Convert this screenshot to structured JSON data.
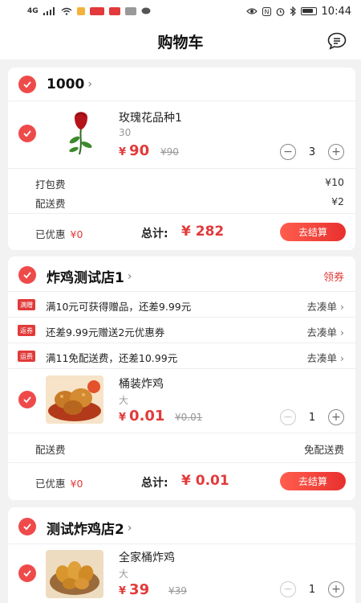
{
  "status_bar": {
    "network": "4G",
    "time": "10:44"
  },
  "header": {
    "title": "购物车",
    "message_icon": "message-icon"
  },
  "stores": [
    {
      "name": "1000",
      "items": [
        {
          "name": "玫瑰花品种1",
          "spec": "30",
          "currency": "¥",
          "price": "90",
          "original_price": "¥90",
          "quantity": "3",
          "image": "rose"
        }
      ],
      "fees": [
        {
          "label": "打包费",
          "value": "¥10"
        },
        {
          "label": "配送费",
          "value": "¥2"
        }
      ],
      "footer": {
        "saved_label": "已优惠",
        "saved_value": "¥0",
        "total_label": "总计:",
        "total_value": "¥ 282",
        "checkout_label": "去结算"
      }
    },
    {
      "name": "炸鸡测试店1",
      "coupon_label": "领券",
      "promos": [
        {
          "tag": "满赠",
          "text": "满10元可获得赠品，还差9.99元",
          "action": "去凑单"
        },
        {
          "tag": "返券",
          "text": "还差9.99元赠送2元优惠券",
          "action": "去凑单"
        },
        {
          "tag": "运费",
          "text": "满11免配送费，还差10.99元",
          "action": "去凑单"
        }
      ],
      "items": [
        {
          "name": "桶装炸鸡",
          "spec": "大",
          "currency": "¥",
          "price": "0.01",
          "original_price": "¥0.01",
          "quantity": "1",
          "image": "fried-chicken"
        }
      ],
      "fees": [
        {
          "label": "配送费",
          "value": "免配送费"
        }
      ],
      "footer": {
        "saved_label": "已优惠",
        "saved_value": "¥0",
        "total_label": "总计:",
        "total_value": "¥ 0.01",
        "checkout_label": "去结算"
      }
    },
    {
      "name": "测试炸鸡店2",
      "items": [
        {
          "name": "全家桶炸鸡",
          "spec": "大",
          "currency": "¥",
          "price": "39",
          "original_price": "¥39",
          "quantity": "1",
          "image": "fried-chicken-bucket"
        }
      ]
    }
  ],
  "colors": {
    "accent": "#e23a3a",
    "check": "#ef4a4a",
    "background": "#f2f2f2"
  }
}
